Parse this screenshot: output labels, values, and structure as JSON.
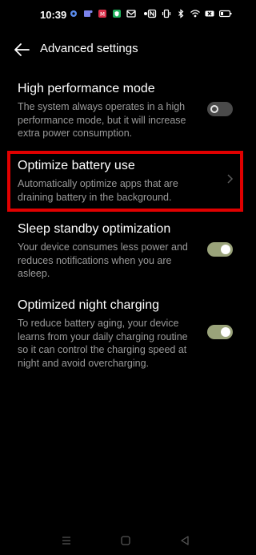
{
  "status_bar": {
    "time": "10:39",
    "left_icons": [
      "settings-gear-icon",
      "teams-icon",
      "app-red-icon",
      "app-green-shield-icon",
      "messenger-icon",
      "dot-icon"
    ],
    "right_icons": [
      "nfc-icon",
      "vibrate-icon",
      "bluetooth-icon",
      "wifi-icon",
      "battery-x-icon",
      "battery-icon"
    ]
  },
  "header": {
    "back_icon": "arrow-left-icon",
    "title": "Advanced settings"
  },
  "settings": [
    {
      "title": "High performance mode",
      "description": "The system always operates in a high performance mode, but it will increase extra power consumption.",
      "control": "toggle",
      "enabled": false
    },
    {
      "title": "Optimize battery use",
      "description": "Automatically optimize apps that are draining battery in the background.",
      "control": "chevron",
      "highlighted": true
    },
    {
      "title": "Sleep standby optimization",
      "description": "Your device consumes less power and reduces notifications when you are asleep.",
      "control": "toggle",
      "enabled": true
    },
    {
      "title": "Optimized night charging",
      "description": "To reduce battery aging, your device learns from your daily charging routine so it can control the charging speed at night and avoid overcharging.",
      "control": "toggle",
      "enabled": true
    }
  ],
  "colors": {
    "background": "#000000",
    "description_text": "#9a9a9a",
    "toggle_on": "#9aa37a",
    "toggle_off": "#4a4a4a",
    "highlight": "#e00000"
  },
  "navbar": {
    "icons": [
      "menu-icon",
      "home-icon",
      "back-triangle-icon"
    ]
  }
}
